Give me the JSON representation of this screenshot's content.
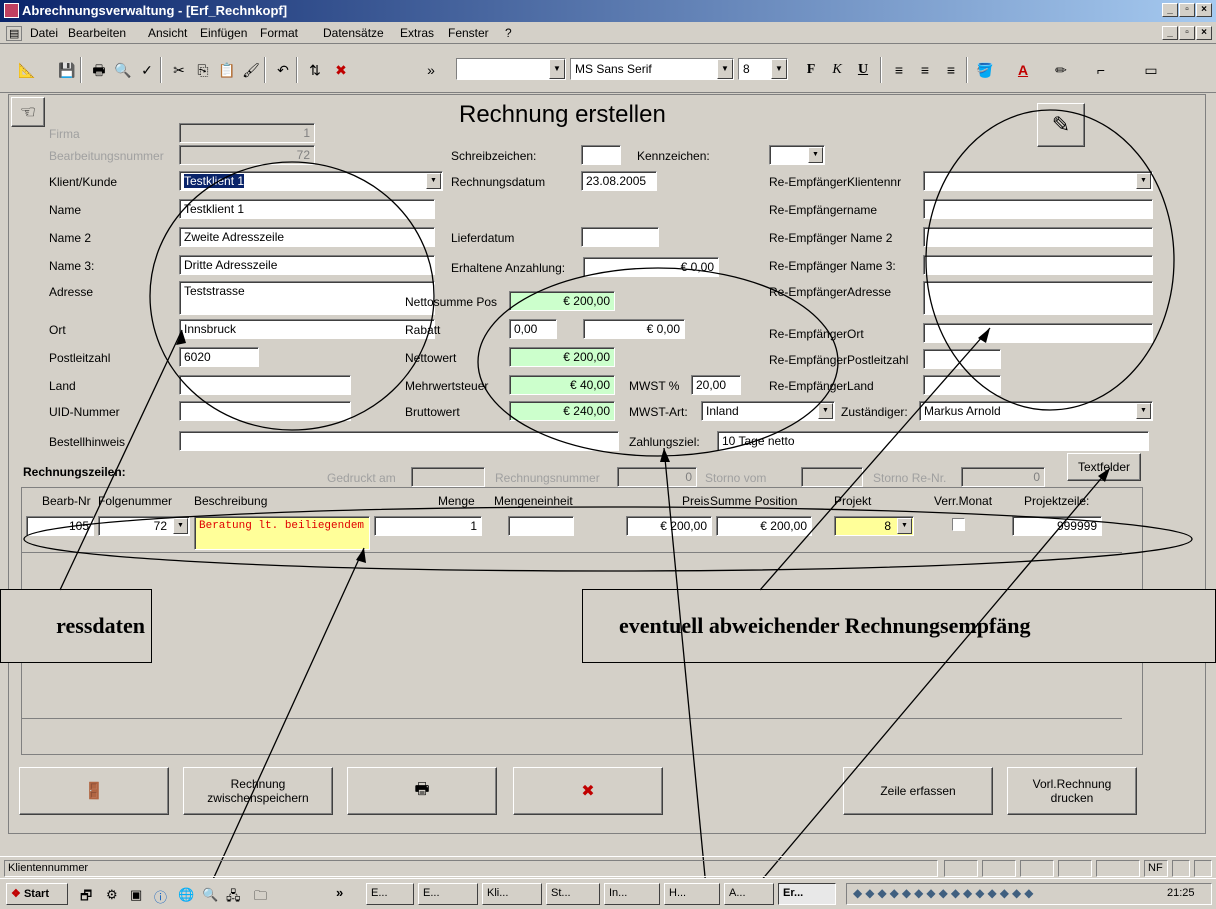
{
  "window": {
    "title": "Abrechnungsverwaltung - [Erf_Rechnkopf]",
    "controls": [
      "_",
      "▫",
      "×"
    ]
  },
  "menu": [
    "Datei",
    "Bearbeiten",
    "Ansicht",
    "Einfügen",
    "Format",
    "Datensätze",
    "Extras",
    "Fenster",
    "?"
  ],
  "toolbar": {
    "font_name": "MS Sans Serif",
    "font_size": "8",
    "bold": "F",
    "italic": "K",
    "underline": "U"
  },
  "form": {
    "title": "Rechnung erstellen",
    "left": {
      "firma": {
        "label": "Firma",
        "value": "1"
      },
      "bearbeitungsnummer": {
        "label": "Bearbeitungsnummer",
        "value": "72"
      },
      "klient": {
        "label": "Klient/Kunde",
        "value": "Testklient 1"
      },
      "name": {
        "label": "Name",
        "value": "Testklient 1"
      },
      "name2": {
        "label": "Name 2",
        "value": "Zweite Adresszeile"
      },
      "name3": {
        "label": "Name 3:",
        "value": "Dritte Adresszeile"
      },
      "adresse": {
        "label": "Adresse",
        "value": "Teststrasse"
      },
      "ort": {
        "label": "Ort",
        "value": "Innsbruck"
      },
      "plz": {
        "label": "Postleitzahl",
        "value": "6020"
      },
      "land": {
        "label": "Land",
        "value": ""
      },
      "uid": {
        "label": "UID-Nummer",
        "value": ""
      },
      "bestellhinweis": {
        "label": "Bestellhinweis",
        "value": ""
      }
    },
    "middle": {
      "schreibzeichen": {
        "label": "Schreibzeichen:",
        "value": ""
      },
      "kennzeichen": {
        "label": "Kennzeichen:",
        "value": ""
      },
      "rechnungsdatum": {
        "label": "Rechnungsdatum",
        "value": "23.08.2005"
      },
      "lieferdatum": {
        "label": "Lieferdatum",
        "value": ""
      },
      "anzahlung": {
        "label": "Erhaltene Anzahlung:",
        "value": "€ 0,00"
      },
      "nettosumme": {
        "label": "Nettosumme Pos",
        "value": "€ 200,00"
      },
      "rabatt": {
        "label": "Rabatt",
        "value": "0,00",
        "amount": "€ 0,00"
      },
      "nettowert": {
        "label": "Nettowert",
        "value": "€ 200,00"
      },
      "mwst": {
        "label": "Mehrwertsteuer",
        "value": "€ 40,00"
      },
      "mwst_pct": {
        "label": "MWST %",
        "value": "20,00"
      },
      "bruttowert": {
        "label": "Bruttowert",
        "value": "€ 240,00"
      },
      "mwst_art": {
        "label": "MWST-Art:",
        "value": "Inland"
      },
      "zahlungsziel": {
        "label": "Zahlungsziel:",
        "value": "10 Tage netto"
      }
    },
    "right": {
      "klientennr": {
        "label": "Re-EmpfängerKlientennr",
        "value": ""
      },
      "name": {
        "label": "Re-Empfängername",
        "value": ""
      },
      "name2": {
        "label": "Re-Empfänger Name 2",
        "value": ""
      },
      "name3": {
        "label": "Re-Empfänger Name 3:",
        "value": ""
      },
      "adresse": {
        "label": "Re-EmpfängerAdresse",
        "value": ""
      },
      "ort": {
        "label": "Re-EmpfängerOrt",
        "value": ""
      },
      "plz": {
        "label": "Re-EmpfängerPostleitzahl",
        "value": ""
      },
      "land": {
        "label": "Re-EmpfängerLand",
        "value": ""
      },
      "zustaendiger": {
        "label": "Zuständiger:",
        "value": "Markus Arnold"
      }
    },
    "lines_section": {
      "title": "Rechnungszeilen:",
      "gedruckt_label": "Gedruckt am",
      "gedruckt_value": "",
      "rechnungsnummer_label": "Rechnungsnummer",
      "rechnungsnummer_value": "0",
      "storno_vom_label": "Storno vom",
      "storno_vom_value": "",
      "storno_renr_label": "Storno Re-Nr.",
      "storno_renr_value": "0",
      "textfelder_button": "Textfelder"
    },
    "columns": [
      "Bearb-Nr",
      "Folgenummer",
      "Beschreibung",
      "Menge",
      "Mengeneinheit",
      "Preis",
      "Summe Position",
      "Projekt",
      "Verr.Monat",
      "Projektzeile:"
    ],
    "row": {
      "bearb_nr": "105",
      "folgenummer": "72",
      "beschreibung": "Beratung lt. beiliegendem",
      "menge": "1",
      "mengeneinheit": "",
      "preis": "€ 200,00",
      "summe": "€ 200,00",
      "projekt": "8",
      "projektzeile": "999999"
    },
    "buttons": {
      "zwischenspeichern": "Rechnung zwischenspeichern",
      "zeile_erfassen": "Zeile erfassen",
      "vorl_rechnung": "Vorl.Rechnung drucken"
    }
  },
  "callouts": {
    "left": "ressdaten",
    "right": "eventuell abweichender Rechnungsempfäng"
  },
  "statusbar": {
    "text": "Klientennummer",
    "mode": "NF"
  },
  "taskbar": {
    "start": "Start",
    "tasks": [
      "E...",
      "E...",
      "Kli...",
      "St...",
      "In...",
      "H...",
      "A...",
      "Er..."
    ],
    "clock": "21:25"
  }
}
